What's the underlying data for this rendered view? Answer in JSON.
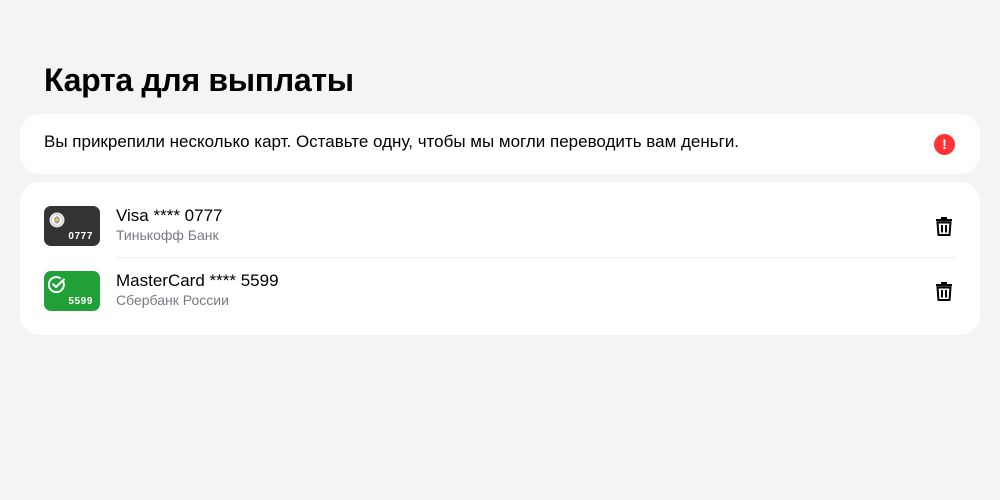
{
  "header": {
    "title": "Карта для выплаты"
  },
  "notice": {
    "text": "Вы прикрепили несколько карт. Оставьте одну, чтобы мы могли переводить вам деньги.",
    "icon": "alert-icon",
    "icon_glyph": "!",
    "icon_color": "#ff3333"
  },
  "cards": [
    {
      "name": "Visa **** 0777",
      "bank": "Тинькофф Банк",
      "thumb_digits": "0777",
      "thumb_color": "#333333",
      "logo": "tinkoff-emblem-icon"
    },
    {
      "name": "MasterCard **** 5599",
      "bank": "Сбербанк России",
      "thumb_digits": "5599",
      "thumb_color": "#21a038",
      "logo": "sber-check-icon"
    }
  ]
}
